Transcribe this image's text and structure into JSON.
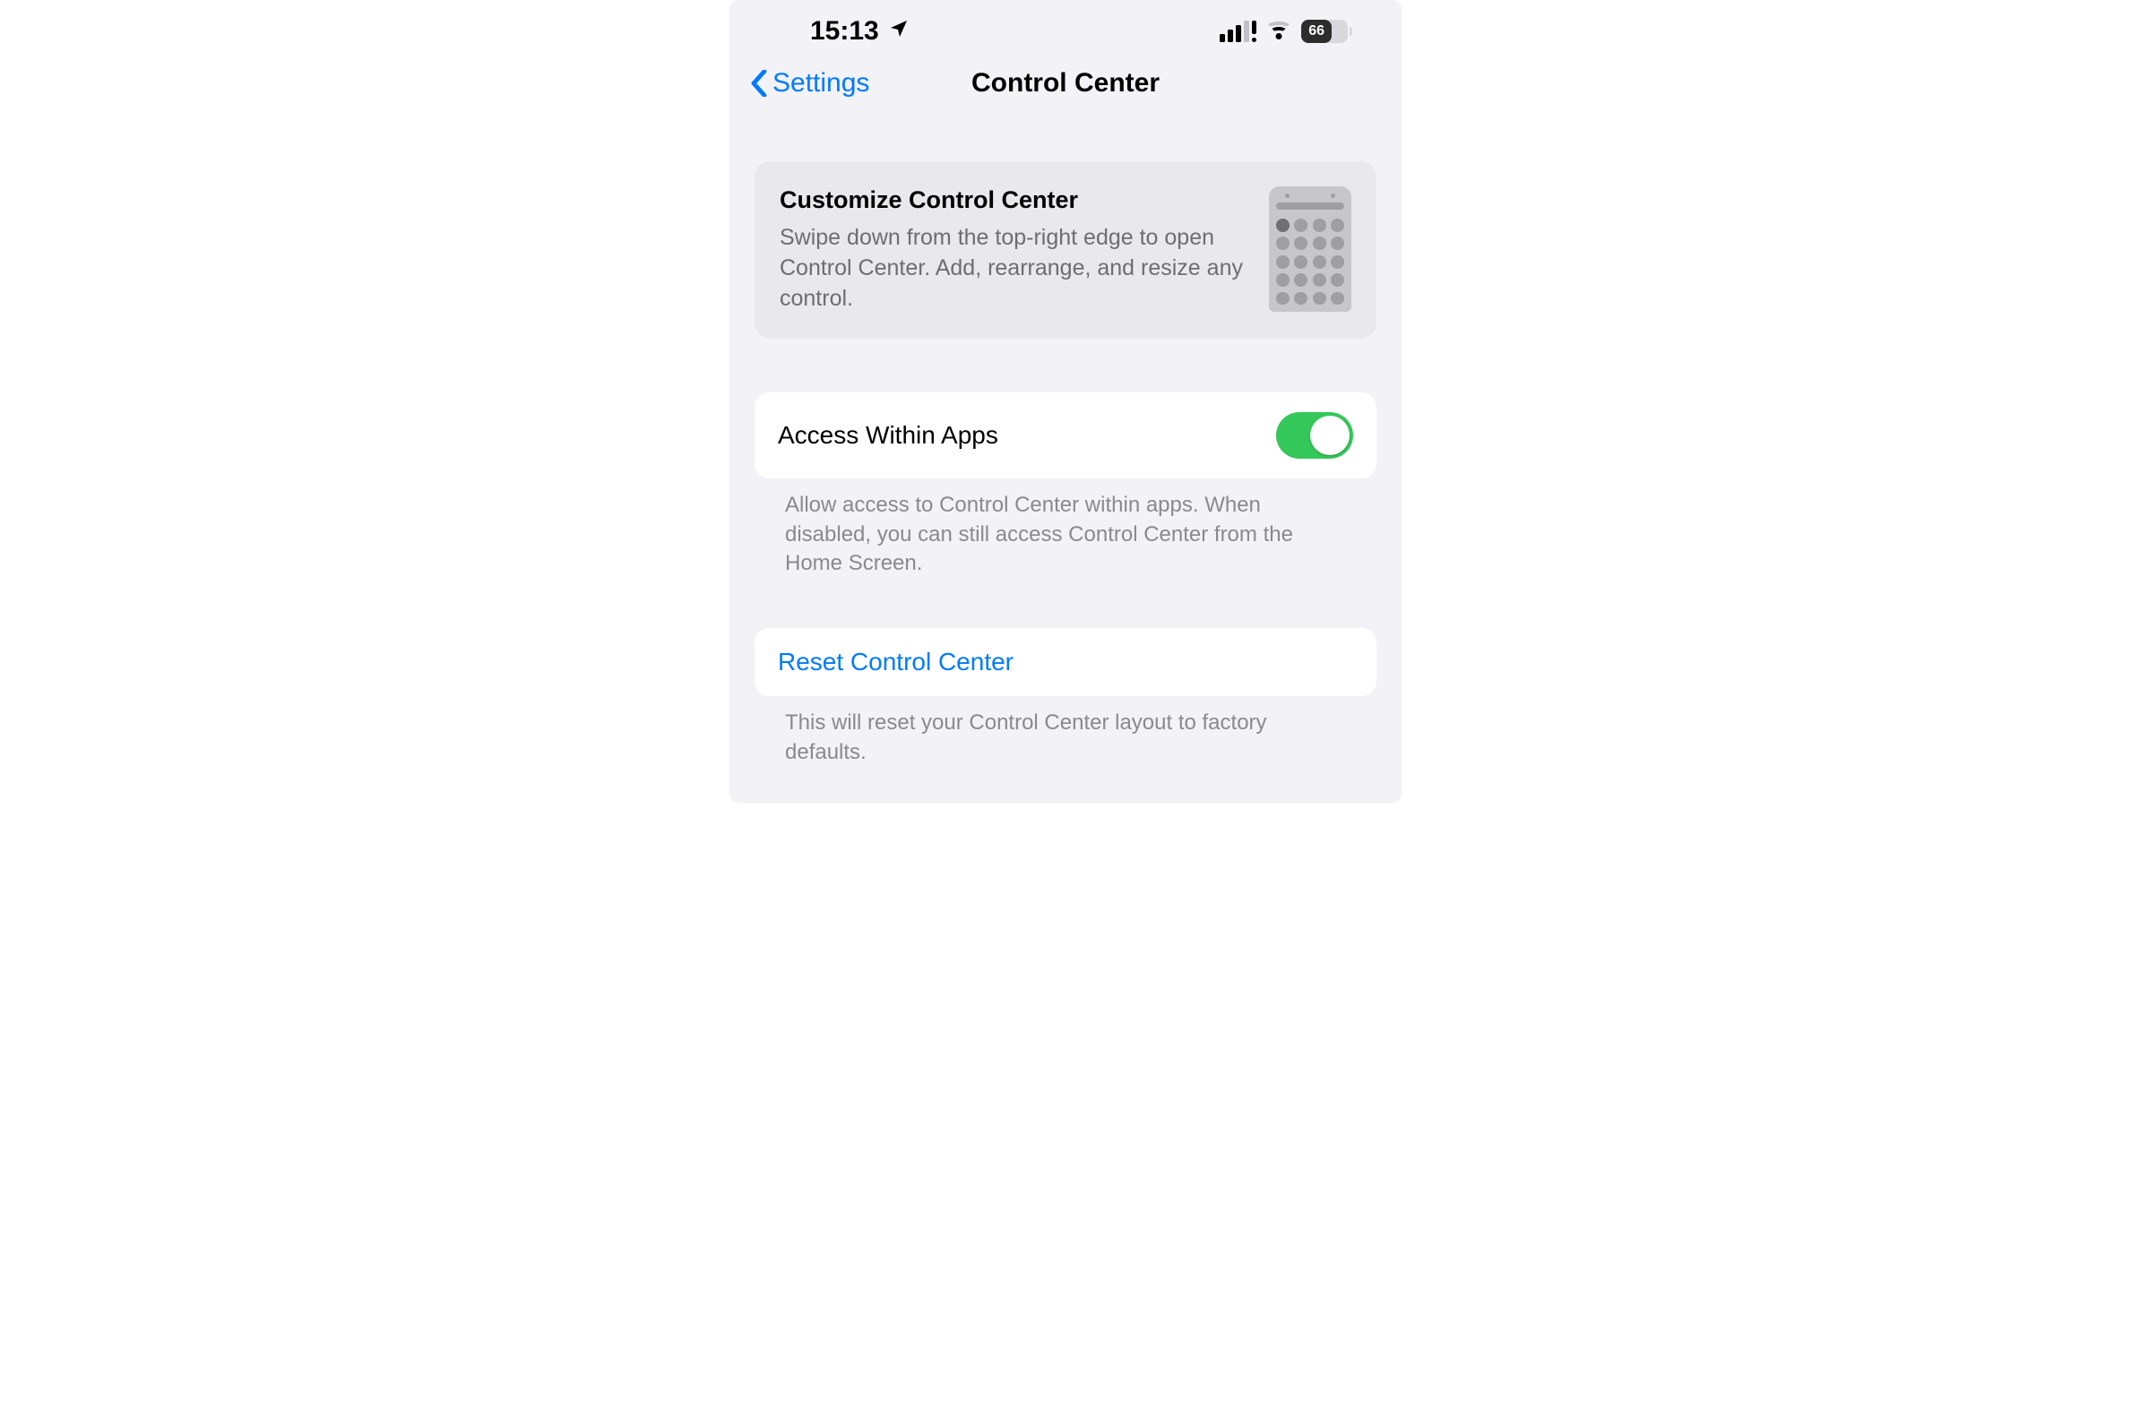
{
  "status_bar": {
    "time": "15:13",
    "battery_percent": "66"
  },
  "nav": {
    "back_label": "Settings",
    "title": "Control Center"
  },
  "promo": {
    "title": "Customize Control Center",
    "description": "Swipe down from the top-right edge to open Control Center. Add, rearrange, and resize any control."
  },
  "access_within_apps": {
    "label": "Access Within Apps",
    "enabled": true,
    "footer": "Allow access to Control Center within apps. When disabled, you can still access Control Center from the Home Screen."
  },
  "reset": {
    "label": "Reset Control Center",
    "footer": "This will reset your Control Center layout to factory defaults."
  },
  "colors": {
    "accent_blue": "#007aff",
    "toggle_green": "#34c759"
  }
}
